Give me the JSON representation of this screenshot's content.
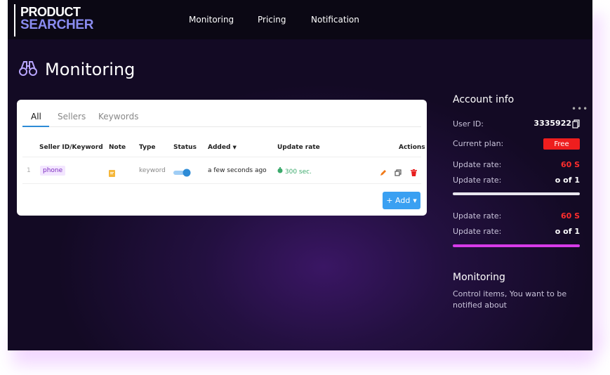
{
  "brand": {
    "line1": "PRODUCT",
    "line2": "SEARCHER"
  },
  "nav": [
    "Monitoring",
    "Pricing",
    "Notification"
  ],
  "page": {
    "title": "Monitoring",
    "icon": "binoculars-icon"
  },
  "tabs": [
    "All",
    "Sellers",
    "Keywords"
  ],
  "table": {
    "headers": {
      "seller": "Seller ID/Keyword",
      "note": "Note",
      "type": "Type",
      "status": "Status",
      "added": "Added",
      "update_rate": "Update rate",
      "actions": "Actions"
    },
    "rows": [
      {
        "index": "1",
        "keyword": "phone",
        "type": "keyword",
        "status_on": true,
        "added": "a few seconds ago",
        "update_rate": "300 sec."
      }
    ]
  },
  "add_button": "+ Add",
  "account": {
    "title": "Account info",
    "user_id_label": "User ID:",
    "user_id": "3335922",
    "plan_label": "Current plan:",
    "plan": "Free",
    "block1": [
      {
        "label": "Update rate:",
        "value": "60 S",
        "color": "#ff2d2d"
      },
      {
        "label": "Update rate:",
        "value": "o of 1",
        "color": "#ffffff"
      }
    ],
    "block2": [
      {
        "label": "Update rate:",
        "value": "60 S",
        "color": "#ff2d2d"
      },
      {
        "label": "Update rate:",
        "value": "o of 1",
        "color": "#ffffff"
      }
    ],
    "bar1_color": "#e8e6ee",
    "bar2_color": "#d63be8"
  },
  "monitoring_info": {
    "title": "Monitoring",
    "text": "Control items, You want to be notified about"
  },
  "colors": {
    "accent": "#3aa0f2",
    "danger": "#ee1e1e",
    "tag_bg": "#f3e6ff"
  }
}
